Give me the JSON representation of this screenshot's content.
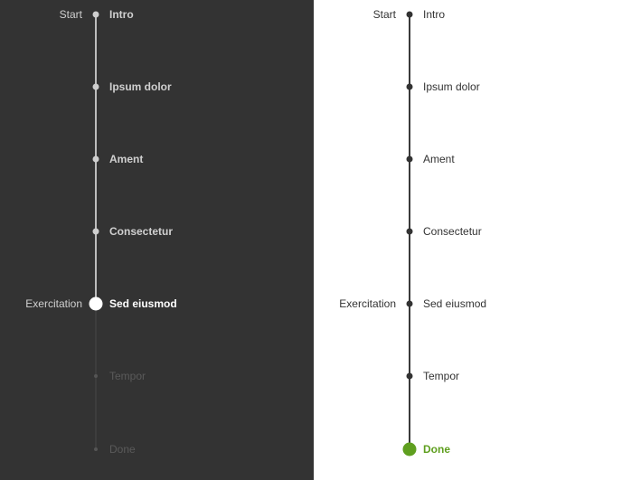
{
  "colors": {
    "dark_bg": "#333333",
    "dark_text": "#d0d0d0",
    "dark_text_future": "#5a5a5a",
    "dark_active": "#ffffff",
    "light_text": "#333333",
    "light_accent": "#5f9f1f"
  },
  "timeline_dark": {
    "steps": [
      {
        "label": "Intro",
        "side": "Start",
        "state": "done"
      },
      {
        "label": "Ipsum dolor",
        "side": "",
        "state": "done"
      },
      {
        "label": "Ament",
        "side": "",
        "state": "done"
      },
      {
        "label": "Consectetur",
        "side": "",
        "state": "done"
      },
      {
        "label": "Sed eiusmod",
        "side": "Exercitation",
        "state": "active"
      },
      {
        "label": "Tempor",
        "side": "",
        "state": "future"
      },
      {
        "label": "Done",
        "side": "",
        "state": "future"
      }
    ]
  },
  "timeline_light": {
    "steps": [
      {
        "label": "Intro",
        "side": "Start",
        "state": "done"
      },
      {
        "label": "Ipsum dolor",
        "side": "",
        "state": "done"
      },
      {
        "label": "Ament",
        "side": "",
        "state": "done"
      },
      {
        "label": "Consectetur",
        "side": "",
        "state": "done"
      },
      {
        "label": "Sed eiusmod",
        "side": "Exercitation",
        "state": "done"
      },
      {
        "label": "Tempor",
        "side": "",
        "state": "done"
      },
      {
        "label": "Done",
        "side": "",
        "state": "active"
      }
    ]
  }
}
